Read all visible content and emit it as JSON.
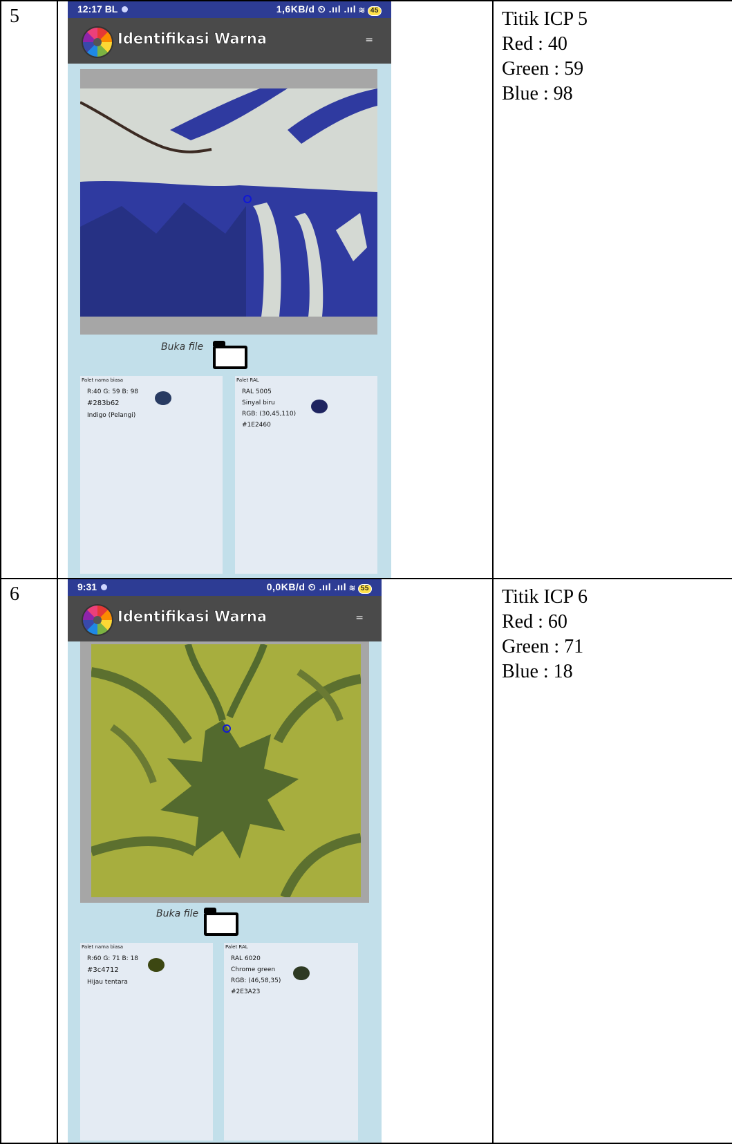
{
  "rows": [
    {
      "number": "5",
      "status": {
        "time": "12:17 BL",
        "right": "1,6KB/d ⏲ .ııl .ııl ≋",
        "battery": "45"
      },
      "app_title": "Identifikasi Warna",
      "menu_icon": "=",
      "buka_label": "Buka file",
      "palette_common": {
        "title": "Palet nama biasa",
        "rgb": "R:40 G: 59 B: 98",
        "hex": "#283b62",
        "name": "Indigo (Pelangi)",
        "swatch_color": "#283b62"
      },
      "palette_ral": {
        "title": "Palet RAL",
        "code": "RAL 5005",
        "name": "Sinyal biru",
        "rgb": "RGB: (30,45,110)",
        "hex": "#1E2460",
        "swatch_color": "#1e2460"
      },
      "info": {
        "title": "Titik ICP 5",
        "red": "Red : 40",
        "green": "Green : 59",
        "blue": "Blue : 98"
      }
    },
    {
      "number": "6",
      "status": {
        "time": "9:31",
        "right": "0,0KB/d ⏲ .ııl .ııl ≋",
        "battery": "55"
      },
      "app_title": "Identifikasi Warna",
      "menu_icon": "=",
      "buka_label": "Buka file",
      "palette_common": {
        "title": "Palet nama biasa",
        "rgb": "R:60 G: 71 B: 18",
        "hex": "#3c4712",
        "name": "Hijau tentara",
        "swatch_color": "#3c4712"
      },
      "palette_ral": {
        "title": "Palet RAL",
        "code": "RAL 6020",
        "name": "Chrome green",
        "rgb": "RGB: (46,58,35)",
        "hex": "#2E3A23",
        "swatch_color": "#2e3a23"
      },
      "info": {
        "title": "Titik ICP 6",
        "red": "Red : 60",
        "green": "Green : 71",
        "blue": "Blue : 18"
      }
    }
  ]
}
